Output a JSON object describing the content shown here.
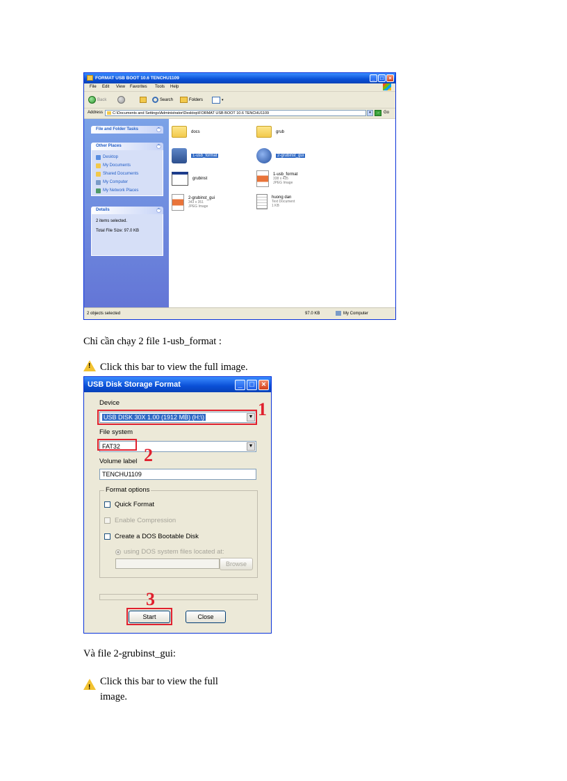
{
  "explorer": {
    "title": "FORMAT USB BOOT 10.6 TENCHU1109",
    "menu": [
      "File",
      "Edit",
      "View",
      "Favorites",
      "Tools",
      "Help"
    ],
    "toolbar": {
      "back": "Back",
      "search": "Search",
      "folders": "Folders"
    },
    "address_label": "Address",
    "address_value": "C:\\Documents and Settings\\Administrator\\Desktop\\FORMAT USB BOOT 10.6 TENCHU1109",
    "go_label": "Go",
    "tasks_header": "File and Folder Tasks",
    "other_places_header": "Other Places",
    "other_places": [
      "Desktop",
      "My Documents",
      "Shared Documents",
      "My Computer",
      "My Network Places"
    ],
    "details_header": "Details",
    "details_lines": [
      "2 items selected.",
      "Total File Size: 97.0 KB"
    ],
    "files": [
      {
        "name": "docs"
      },
      {
        "name": "grub"
      },
      {
        "name": "1-usb_format"
      },
      {
        "name": "2-grubinst_gui"
      },
      {
        "name": "grubinst"
      },
      {
        "name": "1-usb_format",
        "meta1": "338 x 435",
        "meta2": "JPEG Image"
      },
      {
        "name": "2-grubinst_gui",
        "meta1": "343 x 351",
        "meta2": "JPEG Image"
      },
      {
        "name": "huong dan",
        "meta1": "Text Document",
        "meta2": "1 KB"
      }
    ],
    "status": {
      "left": "2 objects selected",
      "size": "97.0 KB",
      "location": "My Computer"
    }
  },
  "text": {
    "para1": "Chỉ cần chạy  2 file  1-usb_format  :",
    "warn1": "Click  this  bar to view  the full  image.",
    "para2": "Và file  2-grubinst_gui:",
    "warn2_line1": "Click  this  bar to view  the full",
    "warn2_line2": "image."
  },
  "usb": {
    "title": "USB Disk Storage Format",
    "device_label": "Device",
    "device_value": "USB DISK 30X 1.00 (1912 MB) (H:\\)",
    "filesystem_label": "File system",
    "filesystem_value": "FAT32",
    "volume_label": "Volume label",
    "volume_value": "TENCHU1109",
    "format_options": "Format options",
    "quick_format": "Quick Format",
    "enable_compression": "Enable Compression",
    "create_dos": "Create a DOS Bootable Disk",
    "using_dos": "using DOS system files located at:",
    "browse": "Browse",
    "start": "Start",
    "close": "Close"
  },
  "annotations": [
    "1",
    "2",
    "3"
  ],
  "colors": {
    "annotation_red": "#e0202e",
    "xp_blue": "#0a4fd6",
    "selection": "#316ac5"
  }
}
